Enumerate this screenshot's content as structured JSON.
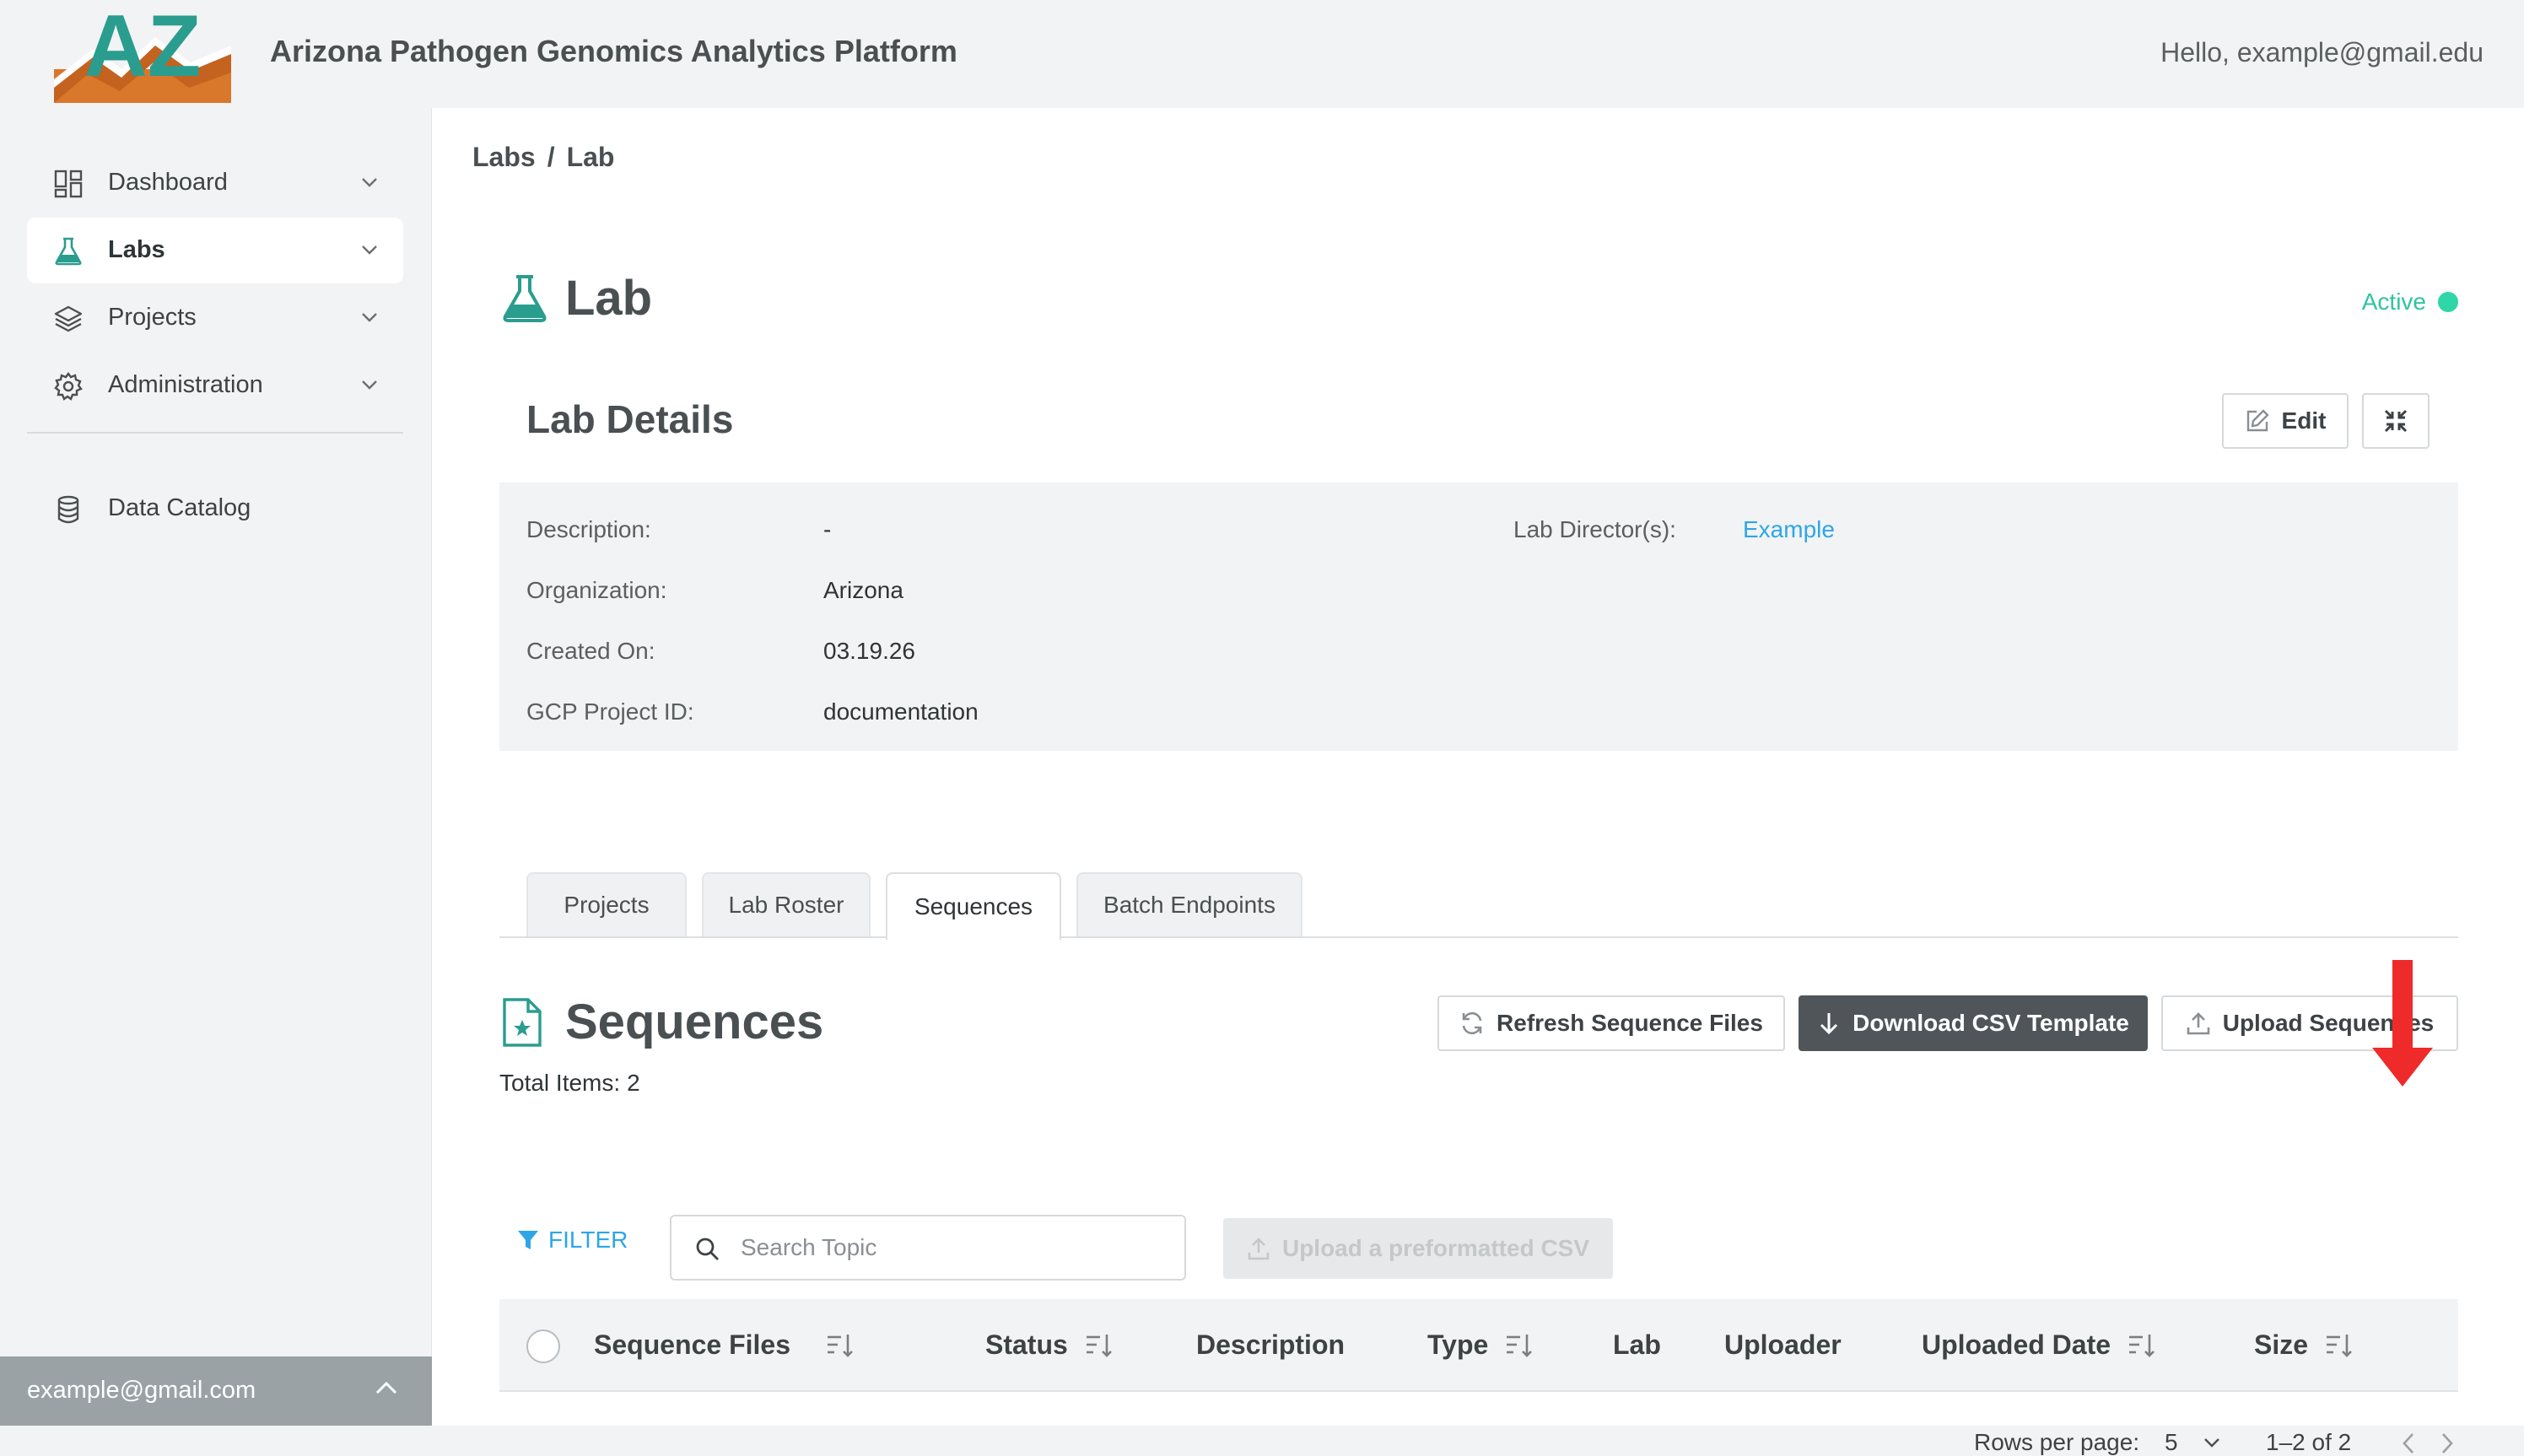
{
  "header": {
    "logo_text": "AZ",
    "app_title": "Arizona Pathogen Genomics Analytics Platform",
    "greeting": "Hello, example@gmail.edu"
  },
  "sidebar": {
    "items": [
      {
        "label": "Dashboard",
        "icon": "dashboard-icon"
      },
      {
        "label": "Labs",
        "icon": "flask-icon",
        "active": true
      },
      {
        "label": "Projects",
        "icon": "layers-icon"
      },
      {
        "label": "Administration",
        "icon": "gear-icon"
      },
      {
        "label": "Data Catalog",
        "icon": "database-icon"
      }
    ],
    "footer_email": "example@gmail.com"
  },
  "breadcrumb": {
    "items": [
      "Labs",
      "Lab"
    ],
    "separator": "/"
  },
  "page": {
    "title": "Lab",
    "status": "Active",
    "status_color": "#2ed6a8"
  },
  "details": {
    "title": "Lab Details",
    "edit_label": "Edit",
    "fields": {
      "description_label": "Description:",
      "description_value": "-",
      "organization_label": "Organization:",
      "organization_value": "Arizona",
      "created_label": "Created On:",
      "created_value": "03.19.26",
      "gcp_label": "GCP Project ID:",
      "gcp_value": "documentation",
      "director_label": "Lab Director(s):",
      "director_value": "Example"
    }
  },
  "tabs": [
    {
      "label": "Projects"
    },
    {
      "label": "Lab Roster"
    },
    {
      "label": "Sequences",
      "active": true
    },
    {
      "label": "Batch Endpoints"
    }
  ],
  "sequences": {
    "title": "Sequences",
    "total_label": "Total Items:",
    "total_count": "2",
    "refresh_label": "Refresh Sequence Files",
    "download_label": "Download CSV Template",
    "upload_label": "Upload Sequences",
    "filter_label": "FILTER",
    "search_placeholder": "Search Topic",
    "upload_csv_label": "Upload a preformatted CSV",
    "columns": [
      {
        "label": "Sequence Files",
        "sortable": true
      },
      {
        "label": "Status",
        "sortable": true
      },
      {
        "label": "Description",
        "sortable": false
      },
      {
        "label": "Type",
        "sortable": true
      },
      {
        "label": "Lab",
        "sortable": false
      },
      {
        "label": "Uploader",
        "sortable": false
      },
      {
        "label": "Uploaded Date",
        "sortable": true
      },
      {
        "label": "Size",
        "sortable": true
      }
    ],
    "pagination": {
      "rows_label": "Rows per page:",
      "rows_value": "5",
      "range": "1–2 of 2"
    }
  },
  "colors": {
    "accent": "#2a9d8f",
    "link": "#2ea6e6",
    "primary_button": "#4f5559",
    "annotation_arrow": "#ee2a2a"
  }
}
